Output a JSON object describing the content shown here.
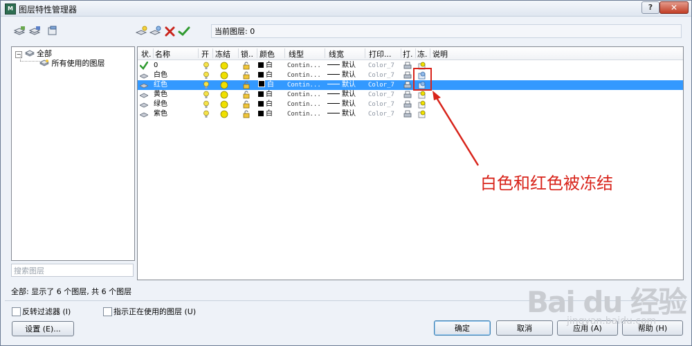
{
  "window": {
    "title": "图层特性管理器",
    "help_glyph": "?",
    "close_glyph": "✕"
  },
  "toolbar": {
    "left_icons": [
      "new-property-filter-icon",
      "new-group-filter-icon",
      "layer-states-manager-icon"
    ],
    "right_icons": [
      "new-layer-icon",
      "new-layer-frozen-icon",
      "delete-layer-icon",
      "set-current-icon"
    ],
    "current_layer": "当前图层: 0"
  },
  "tree": {
    "root": "全部",
    "child": "所有使用的图层"
  },
  "search": {
    "placeholder": "搜索图层"
  },
  "columns": [
    "状.",
    "名称",
    "开",
    "冻结",
    "锁..",
    "颜色",
    "线型",
    "线宽",
    "打印...",
    "打.",
    "冻.",
    "说明"
  ],
  "layers": [
    {
      "name": "0",
      "status": "current",
      "on": true,
      "frozen": false,
      "locked": false,
      "color": "白",
      "linetype": "Contin...",
      "lineweight": "默认",
      "plot_style": "Color_7",
      "plot": true,
      "vp_frozen": false,
      "description": "",
      "selected": false
    },
    {
      "name": "白色",
      "status": "normal",
      "on": true,
      "frozen": false,
      "locked": false,
      "color": "白",
      "linetype": "Contin...",
      "lineweight": "默认",
      "plot_style": "Color_7",
      "plot": true,
      "vp_frozen": true,
      "description": "",
      "selected": false
    },
    {
      "name": "红色",
      "status": "normal",
      "on": true,
      "frozen": false,
      "locked": false,
      "color": "白",
      "linetype": "Contin...",
      "lineweight": "默认",
      "plot_style": "Color_7",
      "plot": true,
      "vp_frozen": true,
      "description": "",
      "selected": true
    },
    {
      "name": "黄色",
      "status": "normal",
      "on": true,
      "frozen": false,
      "locked": false,
      "color": "白",
      "linetype": "Contin...",
      "lineweight": "默认",
      "plot_style": "Color_7",
      "plot": true,
      "vp_frozen": false,
      "description": "",
      "selected": false
    },
    {
      "name": "绿色",
      "status": "normal",
      "on": true,
      "frozen": false,
      "locked": false,
      "color": "白",
      "linetype": "Contin...",
      "lineweight": "默认",
      "plot_style": "Color_7",
      "plot": true,
      "vp_frozen": false,
      "description": "",
      "selected": false
    },
    {
      "name": "紫色",
      "status": "normal",
      "on": true,
      "frozen": false,
      "locked": false,
      "color": "白",
      "linetype": "Contin...",
      "lineweight": "默认",
      "plot_style": "Color_7",
      "plot": true,
      "vp_frozen": false,
      "description": "",
      "selected": false
    }
  ],
  "annotation": {
    "text": "白色和红色被冻结",
    "color": "#d8231a"
  },
  "status": "全部: 显示了 6 个图层, 共 6 个图层",
  "options": {
    "invert_filter": "反转过滤器 (I)",
    "indicate_in_use": "指示正在使用的图层 (U)"
  },
  "buttons": {
    "settings": "设置 (E)...",
    "ok": "确定",
    "cancel": "取消",
    "apply": "应用 (A)",
    "help": "帮助 (H)"
  },
  "watermark": {
    "brand": "Bai du 经验",
    "url": "jingyan.baidu.com"
  },
  "colors": {
    "selection": "#3399ff",
    "accent": "#d8231a",
    "bulb": "#f5e24a",
    "sun": "#f0e000"
  }
}
